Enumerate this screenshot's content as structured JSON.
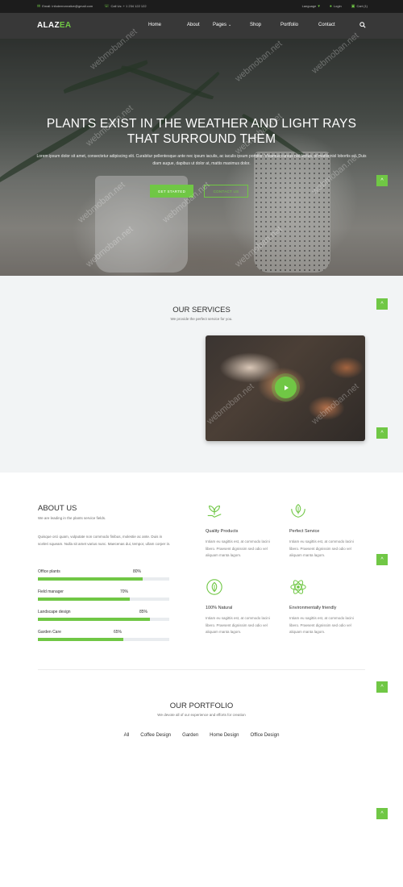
{
  "topbar": {
    "email": "Email: infodeercreative@gmail.com",
    "phone": "Call Us: + 1 234 122 122",
    "language": "Language",
    "login": "Login",
    "cart": "Cart (1)"
  },
  "brand": {
    "prefix": "ALAZ",
    "accent": "EA"
  },
  "nav": {
    "items": [
      "Home",
      "About",
      "Pages",
      "Shop",
      "Portfolio",
      "Contact"
    ]
  },
  "hero": {
    "title": "PLANTS EXIST IN THE WEATHER AND LIGHT RAYS THAT SURROUND THEM",
    "text": "Lorem ipsum dolor sit amet, consectetur adipiscing elit. Curabitur pellentesque ante nec ipsum iaculis, ac iaculis ipsum porttitor. Vivamus cursus nisl lectus, id mattis nisl lobortis eu. Duis diam augue, dapibus ut dolor at, mattis maximus dolor.",
    "btn_primary": "GET STARTED",
    "btn_secondary": "CONTACT US"
  },
  "services": {
    "title": "OUR SERVICES",
    "subtitle": "We provide the perfect service for you."
  },
  "about": {
    "title": "ABOUT US",
    "subtitle": "We are leading in the plants service fields.",
    "text": "Quisque orci quam, vulputate non commodo finibus, molestie ac ante. Duis in sceleri squeam. Nulla sit amet varius nunc. Maecenas dui, tempor, ullam corper in.",
    "skills": [
      {
        "name": "Office plants",
        "percent_label": "80%",
        "value": 0.8
      },
      {
        "name": "Field manager",
        "percent_label": "70%",
        "value": 0.7
      },
      {
        "name": "Landscape design",
        "percent_label": "85%",
        "value": 0.85
      },
      {
        "name": "Garden Care",
        "percent_label": "65%",
        "value": 0.65
      }
    ],
    "features": [
      {
        "title": "Quality Products",
        "text": "Intiam eu sagittis est, at commodo lacini libero. Praesent dignissim sed odio vel aliquam manta lagom.",
        "icon": "plant-hand-icon"
      },
      {
        "title": "Perfect Service",
        "text": "Intiam eu sagittis est, at commodo lacini libero. Praesent dignissim sed odio vel aliquam manta lagom.",
        "icon": "leaf-hands-icon"
      },
      {
        "title": "100% Natural",
        "text": "Intiam eu sagittis est, at commodo lacini libero. Praesent dignissim sed odio vel aliquam manta lagom.",
        "icon": "natural-leaf-icon"
      },
      {
        "title": "Environmentally friendly",
        "text": "Intiam eu sagittis est, at commodo lacini libero. Praesent dignissim sed odio vel aliquam manta lagom.",
        "icon": "eco-atom-icon"
      }
    ]
  },
  "portfolio": {
    "title": "OUR PORTFOLIO",
    "subtitle": "We devote all of our experience and efforts for creation",
    "filters": [
      "All",
      "Coffee Design",
      "Garden",
      "Home Design",
      "Office Design"
    ]
  },
  "back_to_top": "^",
  "watermark": "webmoban.net",
  "colors": {
    "accent": "#70c745",
    "topbar": "#1c1c1c",
    "services_bg": "#f2f4f5"
  }
}
